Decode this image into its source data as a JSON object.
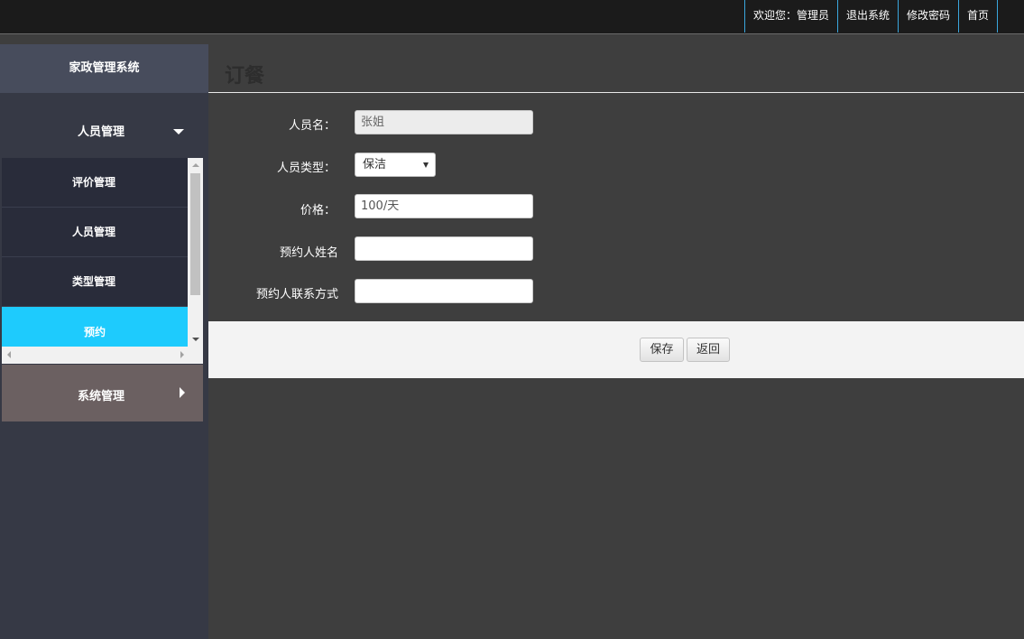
{
  "topnav": {
    "welcome": "欢迎您：管理员",
    "logout": "退出系统",
    "change_password": "修改密码",
    "home": "首页"
  },
  "sidebar": {
    "brand": "家政管理系统",
    "groups": [
      {
        "label": "人员管理",
        "expanded": true
      },
      {
        "label": "系统管理",
        "expanded": false
      }
    ],
    "items": [
      {
        "label": "评价管理"
      },
      {
        "label": "人员管理"
      },
      {
        "label": "类型管理"
      },
      {
        "label": "预约",
        "active": true
      }
    ]
  },
  "page": {
    "title": "订餐"
  },
  "form": {
    "name_label": "人员名：",
    "name_value": "张姐",
    "type_label": "人员类型：",
    "type_value": "保洁",
    "price_label": "价格：",
    "price_value": "100/天",
    "booker_name_label": "预约人姓名",
    "booker_name_value": "",
    "booker_contact_label": "预约人联系方式",
    "booker_contact_value": ""
  },
  "actions": {
    "save": "保存",
    "back": "返回"
  },
  "colors": {
    "accent": "#1ecbfd",
    "topnav_divider": "#3aa7de",
    "sidebar_bg": "#363945",
    "content_bg": "#3e3e3e"
  }
}
